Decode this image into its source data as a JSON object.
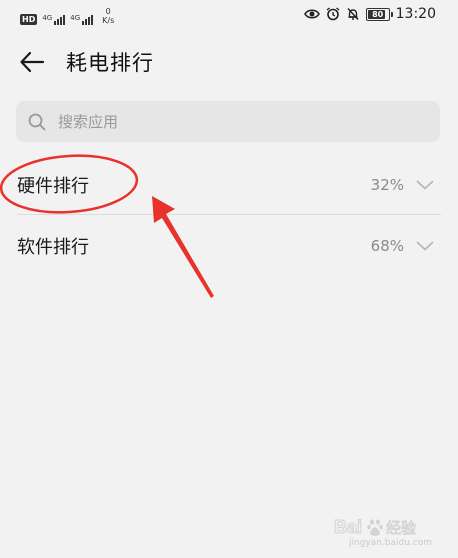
{
  "status_bar": {
    "hd_badge": "HD",
    "signal1_label": "4G",
    "signal2_label": "4G",
    "net_speed_value": "0",
    "net_speed_unit": "K/s",
    "battery_level": "80",
    "time": "13:20"
  },
  "header": {
    "title": "耗电排行"
  },
  "search": {
    "placeholder": "搜索应用"
  },
  "list": {
    "items": [
      {
        "label": "硬件排行",
        "value": "32%"
      },
      {
        "label": "软件排行",
        "value": "68%"
      }
    ]
  },
  "colors": {
    "background": "#f2f2f2",
    "search_bg": "#e6e6e6",
    "annotation_red": "#e8322c"
  },
  "icons": {
    "back": "arrow-left-icon",
    "search": "search-icon",
    "chevron": "chevron-down-icon",
    "status": [
      "eye-icon",
      "alarm-icon",
      "mute-bell-icon"
    ]
  },
  "watermark": {
    "text": "Bai du 经验",
    "subtext": "jingyan.baidu.com"
  }
}
